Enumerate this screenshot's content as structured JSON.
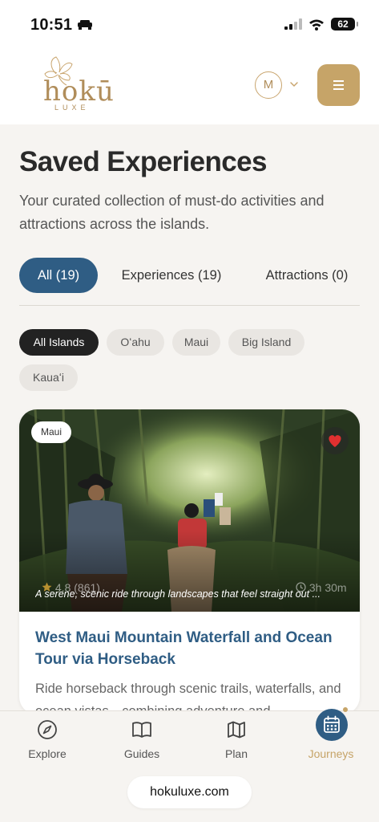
{
  "status_bar": {
    "time": "10:51",
    "battery": "62",
    "icons": [
      "car-icon",
      "signal-icon",
      "wifi-icon",
      "battery-icon"
    ]
  },
  "header": {
    "logo_text": "hokū",
    "logo_subtext": "LUXE",
    "profile_initial": "M",
    "icons": [
      "hibiscus-logo-icon",
      "chevron-down-icon",
      "hamburger-menu-icon"
    ]
  },
  "page": {
    "title": "Saved Experiences",
    "subtitle": "Your curated collection of must-do activities and attractions across the islands."
  },
  "tabs": [
    {
      "label": "All (19)",
      "active": true
    },
    {
      "label": "Experiences (19)",
      "active": false
    },
    {
      "label": "Attractions (0)",
      "active": false
    }
  ],
  "island_filters": [
    {
      "label": "All Islands",
      "active": true
    },
    {
      "label": "Oʻahu",
      "active": false
    },
    {
      "label": "Maui",
      "active": false
    },
    {
      "label": "Big Island",
      "active": false
    },
    {
      "label": "Kauaʻi",
      "active": false
    }
  ],
  "cards": [
    {
      "region": "Maui",
      "rating": "4.8",
      "reviews": "(861)",
      "duration": "3h 30m",
      "caption": "A serene, scenic ride through landscapes that feel straight out ...",
      "title": "West Maui Mountain Waterfall and Ocean Tour via Horseback",
      "description": "Ride horseback through scenic trails, waterfalls, and ocean vistas—combining adventure and",
      "favorited": true,
      "icons": [
        "heart-icon",
        "star-icon",
        "clock-icon"
      ]
    }
  ],
  "bottom_nav": [
    {
      "label": "Explore",
      "icon": "compass-icon",
      "active": false
    },
    {
      "label": "Guides",
      "icon": "book-icon",
      "active": false
    },
    {
      "label": "Plan",
      "icon": "map-icon",
      "active": false
    },
    {
      "label": "Journeys",
      "icon": "calendar-icon",
      "active": true
    }
  ],
  "browser": {
    "domain": "hokuluxe.com"
  },
  "colors": {
    "primary": "#2f5d84",
    "gold": "#c6a468",
    "heart": "#e03030",
    "background": "#f6f4f1"
  }
}
